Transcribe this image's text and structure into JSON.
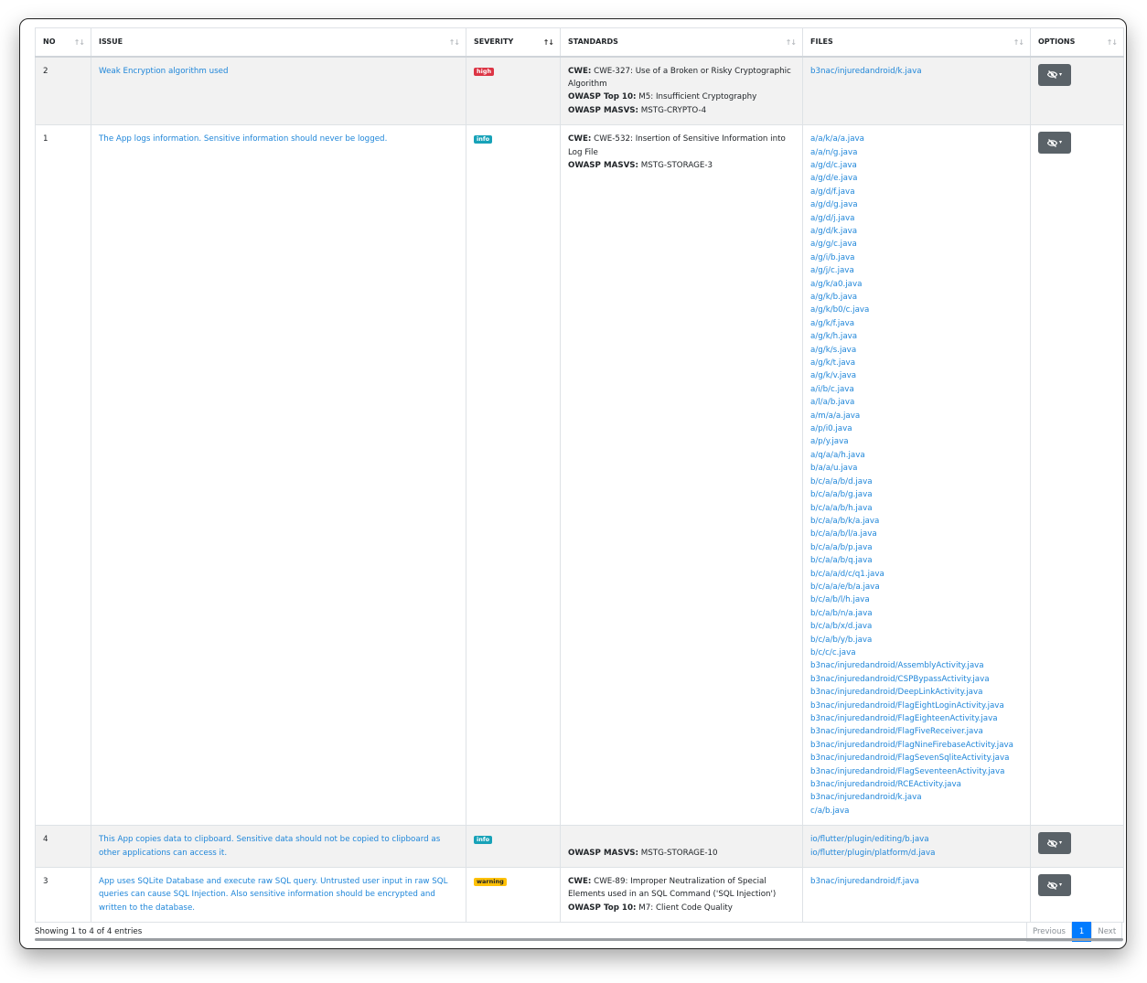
{
  "table": {
    "headers": {
      "no": "NO",
      "issue": "ISSUE",
      "severity": "SEVERITY",
      "standards": "STANDARDS",
      "files": "FILES",
      "options": "OPTIONS"
    },
    "sort_icon": "↑↓",
    "rows": [
      {
        "no": "2",
        "issue": "Weak Encryption algorithm used",
        "severity": "high",
        "standards": [
          {
            "label": "CWE:",
            "value": "CWE-327: Use of a Broken or Risky Cryptographic Algorithm"
          },
          {
            "label": "OWASP Top 10:",
            "value": "M5: Insufficient Cryptography"
          },
          {
            "label": "OWASP MASVS:",
            "value": "MSTG-CRYPTO-4"
          }
        ],
        "files": [
          "b3nac/injuredandroid/k.java"
        ]
      },
      {
        "no": "1",
        "issue": "The App logs information. Sensitive information should never be logged.",
        "severity": "info",
        "standards": [
          {
            "label": "CWE:",
            "value": "CWE-532: Insertion of Sensitive Information into Log File"
          },
          {
            "label": "OWASP MASVS:",
            "value": "MSTG-STORAGE-3"
          }
        ],
        "files": [
          "a/a/k/a/a.java",
          "a/a/n/g.java",
          "a/g/d/c.java",
          "a/g/d/e.java",
          "a/g/d/f.java",
          "a/g/d/g.java",
          "a/g/d/j.java",
          "a/g/d/k.java",
          "a/g/g/c.java",
          "a/g/i/b.java",
          "a/g/j/c.java",
          "a/g/k/a0.java",
          "a/g/k/b.java",
          "a/g/k/b0/c.java",
          "a/g/k/f.java",
          "a/g/k/h.java",
          "a/g/k/s.java",
          "a/g/k/t.java",
          "a/g/k/v.java",
          "a/i/b/c.java",
          "a/l/a/b.java",
          "a/m/a/a.java",
          "a/p/i0.java",
          "a/p/y.java",
          "a/q/a/a/h.java",
          "b/a/a/u.java",
          "b/c/a/a/b/d.java",
          "b/c/a/a/b/g.java",
          "b/c/a/a/b/h.java",
          "b/c/a/a/b/k/a.java",
          "b/c/a/a/b/l/a.java",
          "b/c/a/a/b/p.java",
          "b/c/a/a/b/q.java",
          "b/c/a/a/d/c/q1.java",
          "b/c/a/a/e/b/a.java",
          "b/c/a/b/l/h.java",
          "b/c/a/b/n/a.java",
          "b/c/a/b/x/d.java",
          "b/c/a/b/y/b.java",
          "b/c/c/c.java",
          "b3nac/injuredandroid/AssemblyActivity.java",
          "b3nac/injuredandroid/CSPBypassActivity.java",
          "b3nac/injuredandroid/DeepLinkActivity.java",
          "b3nac/injuredandroid/FlagEightLoginActivity.java",
          "b3nac/injuredandroid/FlagEighteenActivity.java",
          "b3nac/injuredandroid/FlagFiveReceiver.java",
          "b3nac/injuredandroid/FlagNineFirebaseActivity.java",
          "b3nac/injuredandroid/FlagSevenSqliteActivity.java",
          "b3nac/injuredandroid/FlagSeventeenActivity.java",
          "b3nac/injuredandroid/RCEActivity.java",
          "b3nac/injuredandroid/k.java",
          "c/a/b.java"
        ]
      },
      {
        "no": "4",
        "issue": "This App copies data to clipboard. Sensitive data should not be copied to clipboard as other applications can access it.",
        "severity": "info",
        "standards": [
          {
            "label": "",
            "value": ""
          },
          {
            "label": "OWASP MASVS:",
            "value": "MSTG-STORAGE-10"
          }
        ],
        "files": [
          "io/flutter/plugin/editing/b.java",
          "io/flutter/plugin/platform/d.java"
        ]
      },
      {
        "no": "3",
        "issue": "App uses SQLite Database and execute raw SQL query. Untrusted user input in raw SQL queries can cause SQL Injection. Also sensitive information should be encrypted and written to the database.",
        "severity": "warning",
        "standards": [
          {
            "label": "CWE:",
            "value": "CWE-89: Improper Neutralization of Special Elements used in an SQL Command ('SQL Injection')"
          },
          {
            "label": "OWASP Top 10:",
            "value": "M7: Client Code Quality"
          }
        ],
        "files": [
          "b3nac/injuredandroid/f.java"
        ]
      }
    ]
  },
  "footer": {
    "info": "Showing 1 to 4 of 4 entries",
    "previous": "Previous",
    "page": "1",
    "next": "Next"
  },
  "icons": {
    "options": "eye-slash-icon",
    "caret": "caret-down-icon"
  },
  "colors": {
    "link": "#1f86d9",
    "high": "#dc3545",
    "info": "#17a2b8",
    "warning": "#ffc107",
    "button": "#5a6268",
    "page_active": "#007bff"
  }
}
